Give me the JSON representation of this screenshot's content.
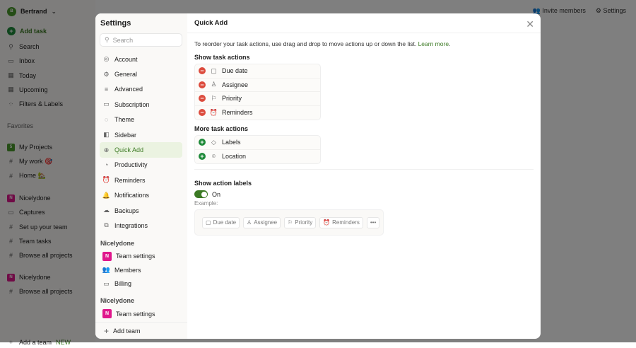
{
  "app": {
    "user": "Bertrand",
    "add_task": "Add task",
    "nav": [
      "Search",
      "Inbox",
      "Today",
      "Upcoming",
      "Filters & Labels"
    ],
    "favorites_label": "Favorites",
    "favorites": [
      "My Projects",
      "My work 🎯",
      "Home 🏡"
    ],
    "team1": "Nicelydone",
    "team1_items": [
      "Captures",
      "Set up your team",
      "Team tasks",
      "Browse all projects"
    ],
    "team2": "Nicelydone",
    "team2_items": [
      "Browse all projects"
    ],
    "add_team": "Add a team",
    "new_badge": "NEW",
    "invite": "Invite members",
    "settings": "Settings"
  },
  "settings": {
    "title": "Settings",
    "search_placeholder": "Search",
    "items": [
      {
        "label": "Account",
        "icon": "account-icon",
        "g": "◎"
      },
      {
        "label": "General",
        "icon": "gear-icon",
        "g": "⚙"
      },
      {
        "label": "Advanced",
        "icon": "sliders-icon",
        "g": "≡"
      },
      {
        "label": "Subscription",
        "icon": "wallet-icon",
        "g": "▭"
      },
      {
        "label": "Theme",
        "icon": "palette-icon",
        "g": "◌"
      },
      {
        "label": "Sidebar",
        "icon": "sidebar-icon",
        "g": "◧"
      },
      {
        "label": "Quick Add",
        "icon": "quick-add-icon",
        "g": "⊕",
        "active": true
      },
      {
        "label": "Productivity",
        "icon": "productivity-icon",
        "g": "◔"
      },
      {
        "label": "Reminders",
        "icon": "alarm-icon",
        "g": "⏰"
      },
      {
        "label": "Notifications",
        "icon": "bell-icon",
        "g": "🔔"
      },
      {
        "label": "Backups",
        "icon": "cloud-upload-icon",
        "g": "☁"
      },
      {
        "label": "Integrations",
        "icon": "puzzle-icon",
        "g": "⧉"
      }
    ],
    "team_a": "Nicelydone",
    "team_a_items": [
      "Team settings",
      "Members",
      "Billing"
    ],
    "team_b": "Nicelydone",
    "team_b_items": [
      "Team settings"
    ],
    "add_team": "Add team"
  },
  "quick_add": {
    "title": "Quick Add",
    "description": "To reorder your task actions, use drag and drop to move actions up or down the list.",
    "learn_more": "Learn more",
    "show_heading": "Show task actions",
    "shown": [
      {
        "label": "Due date",
        "icon": "calendar-icon",
        "g": "▢"
      },
      {
        "label": "Assignee",
        "icon": "person-icon",
        "g": "♙"
      },
      {
        "label": "Priority",
        "icon": "flag-icon",
        "g": "⚐"
      },
      {
        "label": "Reminders",
        "icon": "alarm-icon",
        "g": "⏰"
      }
    ],
    "more_heading": "More task actions",
    "more": [
      {
        "label": "Labels",
        "icon": "tag-icon",
        "g": "◇"
      },
      {
        "label": "Location",
        "icon": "location-pin-icon",
        "g": "⌾"
      }
    ],
    "labels_heading": "Show action labels",
    "toggle_state": "On",
    "toggle_on": true,
    "example_label": "Example:",
    "example_chips": [
      {
        "label": "Due date",
        "icon": "calendar-icon",
        "g": "▢"
      },
      {
        "label": "Assignee",
        "icon": "person-icon",
        "g": "♙"
      },
      {
        "label": "Priority",
        "icon": "flag-icon",
        "g": "⚐"
      },
      {
        "label": "Reminders",
        "icon": "alarm-icon",
        "g": "⏰"
      }
    ],
    "more_chip": "•••"
  },
  "colors": {
    "accent": "#3c7a24",
    "remove": "#dc4c3e",
    "add": "#1f8a3a",
    "team": "#e0178c"
  }
}
